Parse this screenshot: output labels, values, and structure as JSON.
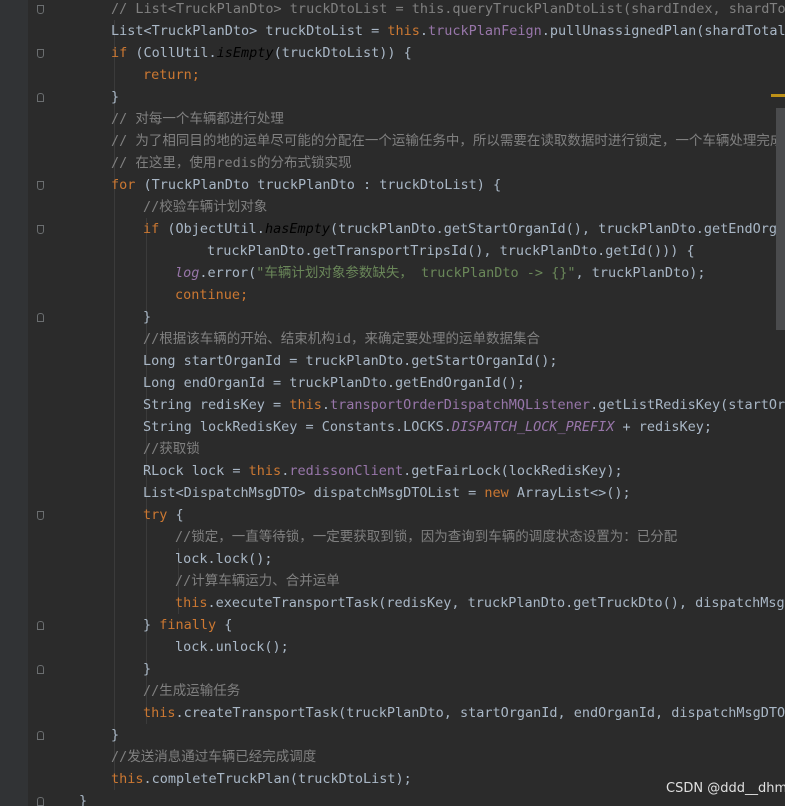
{
  "editor": {
    "theme": "darcula",
    "colors": {
      "background": "#2b2b2b",
      "keyword": "#cc7832",
      "comment": "#808080",
      "string": "#6a8759",
      "field": "#9876aa",
      "plain": "#a9b7c6"
    },
    "lines": [
      {
        "t": [
          [
            "// List<TruckPlanDto> truckDtoList = this.queryTruckPlanDtoList(shardIndex, shardTotal",
            "cm"
          ]
        ]
      },
      {
        "t": [
          [
            "List<TruckPlanDto> truckDtoList = ",
            "plain"
          ],
          [
            "this",
            "kw"
          ],
          [
            ".",
            "plain"
          ],
          [
            "truckPlanFeign",
            "fld"
          ],
          [
            ".pullUnassignedPlan(shardTotal, ",
            "plain"
          ]
        ]
      },
      {
        "t": [
          [
            "if ",
            "kw"
          ],
          [
            "(CollUtil.",
            "plain"
          ],
          [
            "isEmpty",
            "ital"
          ],
          [
            "(truckDtoList)) {",
            "plain"
          ]
        ]
      },
      {
        "t": [
          [
            "return;",
            "kw"
          ]
        ]
      },
      {
        "t": [
          [
            "}",
            "plain"
          ]
        ]
      },
      {
        "t": [
          [
            "// 对每一个车辆都进行处理",
            "cm"
          ]
        ]
      },
      {
        "t": [
          [
            "// 为了相同目的地的运单尽可能的分配在一个运输任务中，所以需要在读取数据时进行锁定，一个车辆处理完成后再",
            "cm"
          ]
        ]
      },
      {
        "t": [
          [
            "// 在这里，使用redis的分布式锁实现",
            "cm"
          ]
        ]
      },
      {
        "t": [
          [
            "for ",
            "kw"
          ],
          [
            "(TruckPlanDto truckPlanDto : truckDtoList) {",
            "plain"
          ]
        ]
      },
      {
        "t": [
          [
            "//校验车辆计划对象",
            "cm"
          ]
        ]
      },
      {
        "t": [
          [
            "if ",
            "kw"
          ],
          [
            "(ObjectUtil.",
            "plain"
          ],
          [
            "hasEmpty",
            "ital"
          ],
          [
            "(truckPlanDto.getStartOrganId(), truckPlanDto.getEndOrgani",
            "plain"
          ]
        ]
      },
      {
        "t": [
          [
            "truckPlanDto.getTransportTripsId(), truckPlanDto.getId())) {",
            "plain"
          ]
        ]
      },
      {
        "t": [
          [
            "log",
            "sfld"
          ],
          [
            ".error(",
            "plain"
          ],
          [
            "\"车辆计划对象参数缺失， truckPlanDto -> {}\"",
            "str"
          ],
          [
            ", truckPlanDto);",
            "plain"
          ]
        ]
      },
      {
        "t": [
          [
            "continue;",
            "kw"
          ]
        ]
      },
      {
        "t": [
          [
            "}",
            "plain"
          ]
        ]
      },
      {
        "t": [
          [
            "//根据该车辆的开始、结束机构id，来确定要处理的运单数据集合",
            "cm"
          ]
        ]
      },
      {
        "t": [
          [
            "Long startOrganId = truckPlanDto.getStartOrganId();",
            "plain"
          ]
        ]
      },
      {
        "t": [
          [
            "Long endOrganId = truckPlanDto.getEndOrganId();",
            "plain"
          ]
        ]
      },
      {
        "t": [
          [
            "String redisKey = ",
            "plain"
          ],
          [
            "this",
            "kw"
          ],
          [
            ".",
            "plain"
          ],
          [
            "transportOrderDispatchMQListener",
            "fld"
          ],
          [
            ".getListRedisKey(startOrga",
            "plain"
          ]
        ]
      },
      {
        "t": [
          [
            "String lockRedisKey = Constants.LOCKS.",
            "plain"
          ],
          [
            "DISPATCH_LOCK_PREFIX",
            "sfld"
          ],
          [
            " + redisKey;",
            "plain"
          ]
        ]
      },
      {
        "t": [
          [
            "//获取锁",
            "cm"
          ]
        ]
      },
      {
        "t": [
          [
            "RLock lock = ",
            "plain"
          ],
          [
            "this",
            "kw"
          ],
          [
            ".",
            "plain"
          ],
          [
            "redissonClient",
            "fld"
          ],
          [
            ".getFairLock(lockRedisKey);",
            "plain"
          ]
        ]
      },
      {
        "t": [
          [
            "List<DispatchMsgDTO> dispatchMsgDTOList = ",
            "plain"
          ],
          [
            "new ",
            "kw"
          ],
          [
            "ArrayList<>();",
            "plain"
          ]
        ]
      },
      {
        "t": [
          [
            "try ",
            "kw"
          ],
          [
            "{",
            "plain"
          ]
        ]
      },
      {
        "t": [
          [
            "//锁定，一直等待锁，一定要获取到锁，因为查询到车辆的调度状态设置为：已分配",
            "cm"
          ]
        ]
      },
      {
        "t": [
          [
            "lock.lock();",
            "plain"
          ]
        ]
      },
      {
        "t": [
          [
            "//计算车辆运力、合并运单",
            "cm"
          ]
        ]
      },
      {
        "t": [
          [
            "this",
            "kw"
          ],
          [
            ".executeTransportTask(redisKey, truckPlanDto.getTruckDto(), dispatchMsgD",
            "plain"
          ]
        ]
      },
      {
        "t": [
          [
            "} ",
            "plain"
          ],
          [
            "finally ",
            "kw"
          ],
          [
            "{",
            "plain"
          ]
        ]
      },
      {
        "t": [
          [
            "lock.unlock();",
            "plain"
          ]
        ]
      },
      {
        "t": [
          [
            "}",
            "plain"
          ]
        ]
      },
      {
        "t": [
          [
            "//生成运输任务",
            "cm"
          ]
        ]
      },
      {
        "t": [
          [
            "this",
            "kw"
          ],
          [
            ".createTransportTask(truckPlanDto, startOrganId, endOrganId, dispatchMsgDTOLis",
            "plain"
          ]
        ]
      },
      {
        "t": [
          [
            "}",
            "plain"
          ]
        ]
      },
      {
        "t": [
          [
            "//发送消息通过车辆已经完成调度",
            "cm"
          ]
        ]
      },
      {
        "t": [
          [
            "this",
            "kw"
          ],
          [
            ".completeTruckPlan(truckDtoList);",
            "plain"
          ]
        ]
      },
      {
        "t": [
          [
            "}",
            "plain"
          ]
        ]
      }
    ]
  },
  "watermark": {
    "text": "CSDN @ddd__dhm"
  }
}
